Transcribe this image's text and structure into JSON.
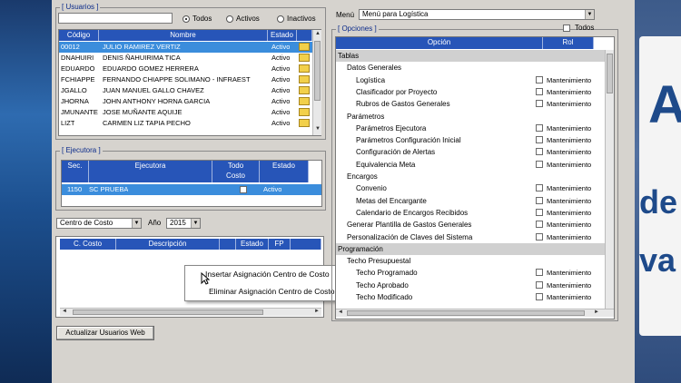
{
  "background": {
    "right_text_lines": [
      "A",
      "de",
      "va"
    ]
  },
  "usuarios": {
    "group_title": "[ Usuarios ]",
    "search_value": "",
    "filters": [
      {
        "label": "Todos",
        "selected": true
      },
      {
        "label": "Activos",
        "selected": false
      },
      {
        "label": "Inactivos",
        "selected": false
      }
    ],
    "columns": [
      "Código",
      "Nombre",
      "Estado"
    ],
    "rows": [
      {
        "codigo": "00012",
        "nombre": "JULIO RAMIREZ VERTIZ",
        "estado": "Activo",
        "selected": true
      },
      {
        "codigo": "DNAHUIRI",
        "nombre": "DENIS ÑAHUIRIMA TICA",
        "estado": "Activo"
      },
      {
        "codigo": "EDUARDO",
        "nombre": "EDUARDO GOMEZ HERRERA",
        "estado": "Activo"
      },
      {
        "codigo": "FCHIAPPE",
        "nombre": "FERNANDO CHIAPPE SOLIMANO - INFRAEST",
        "estado": "Activo"
      },
      {
        "codigo": "JGALLO",
        "nombre": "JUAN MANUEL GALLO CHAVEZ",
        "estado": "Activo"
      },
      {
        "codigo": "JHORNA",
        "nombre": "JOHN ANTHONY HORNA GARCIA",
        "estado": "Activo"
      },
      {
        "codigo": "JMUNANTE",
        "nombre": "JOSE MUÑANTE AQUIJE",
        "estado": "Activo"
      },
      {
        "codigo": "LIZT",
        "nombre": "CARMEN LIZ TAPIA PECHO",
        "estado": "Activo"
      }
    ]
  },
  "ejecutora": {
    "group_title": "[ Ejecutora ]",
    "columns": [
      "Sec.",
      "Ejecutora",
      "Todo Costo",
      "Estado"
    ],
    "rows": [
      {
        "sec": "1150",
        "ejecutora": "SC PRUEBA",
        "estado": "Activo",
        "selected": true
      }
    ]
  },
  "costo": {
    "tipo_value": "Centro de Costo",
    "anio_label": "Año",
    "anio_value": "2015",
    "columns": [
      "C. Costo",
      "Descripción",
      "Estado",
      "FP"
    ]
  },
  "context_menu": {
    "items": [
      "Insertar Asignación Centro de Costo",
      "Eliminar Asignación Centro de Costo"
    ]
  },
  "actualizar_button": "Actualizar Usuarios Web",
  "menu": {
    "label": "Menú",
    "value": "Menú para Logística"
  },
  "opciones": {
    "group_title": "[ Opciones ]",
    "todos_label": "Todos",
    "columns": [
      "Opción",
      "Rol"
    ],
    "rows": [
      {
        "text": "Tablas",
        "level": 0,
        "section": true
      },
      {
        "text": "Datos Generales",
        "level": 1
      },
      {
        "text": "Logística",
        "level": 2,
        "rol": "Mantenimiento"
      },
      {
        "text": "Clasificador por Proyecto",
        "level": 2,
        "rol": "Mantenimiento"
      },
      {
        "text": "Rubros de Gastos Generales",
        "level": 2,
        "rol": "Mantenimiento"
      },
      {
        "text": "Parámetros",
        "level": 1
      },
      {
        "text": "Parámetros Ejecutora",
        "level": 2,
        "rol": "Mantenimiento"
      },
      {
        "text": "Parámetros Configuración Inicial",
        "level": 2,
        "rol": "Mantenimiento"
      },
      {
        "text": "Configuración de Alertas",
        "level": 2,
        "rol": "Mantenimiento"
      },
      {
        "text": "Equivalencia Meta",
        "level": 2,
        "rol": "Mantenimiento"
      },
      {
        "text": "Encargos",
        "level": 1
      },
      {
        "text": "Convenio",
        "level": 2,
        "rol": "Mantenimiento"
      },
      {
        "text": "Metas del Encargante",
        "level": 2,
        "rol": "Mantenimiento"
      },
      {
        "text": "Calendario de Encargos Recibidos",
        "level": 2,
        "rol": "Mantenimiento"
      },
      {
        "text": "Generar Plantilla de Gastos Generales",
        "level": 1,
        "rol": "Mantenimiento"
      },
      {
        "text": "Personalización de Claves del Sistema",
        "level": 1,
        "rol": "Mantenimiento"
      },
      {
        "text": "Programación",
        "level": 0,
        "section": true
      },
      {
        "text": "Techo Presupuestal",
        "level": 1
      },
      {
        "text": "Techo Programado",
        "level": 2,
        "rol": "Mantenimiento"
      },
      {
        "text": "Techo Aprobado",
        "level": 2,
        "rol": "Mantenimiento"
      },
      {
        "text": "Techo Modificado",
        "level": 2,
        "rol": "Mantenimiento"
      }
    ]
  }
}
